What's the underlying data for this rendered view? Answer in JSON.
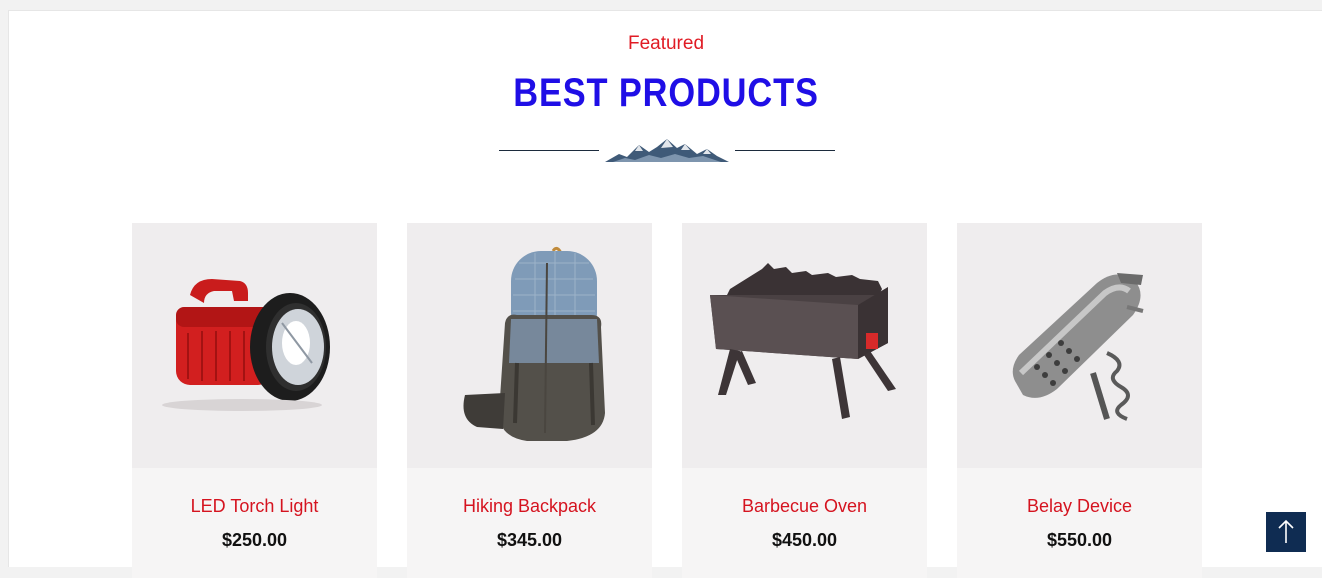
{
  "section": {
    "eyebrow": "Featured",
    "title": "BEST PRODUCTS",
    "divider_icon": "mountains-icon"
  },
  "products": [
    {
      "name": "LED Torch Light",
      "price": "$250.00",
      "icon": "torch-image"
    },
    {
      "name": "Hiking Backpack",
      "price": "$345.00",
      "icon": "backpack-image"
    },
    {
      "name": "Barbecue Oven",
      "price": "$450.00",
      "icon": "barbecue-image"
    },
    {
      "name": "Belay Device",
      "price": "$550.00",
      "icon": "multitool-image"
    }
  ],
  "back_to_top": {
    "icon": "arrow-up-icon"
  },
  "colors": {
    "eyebrow": "#e01b24",
    "title": "#1f0ee6",
    "product_name": "#d5131f",
    "back_to_top_bg": "#0f2c52"
  }
}
